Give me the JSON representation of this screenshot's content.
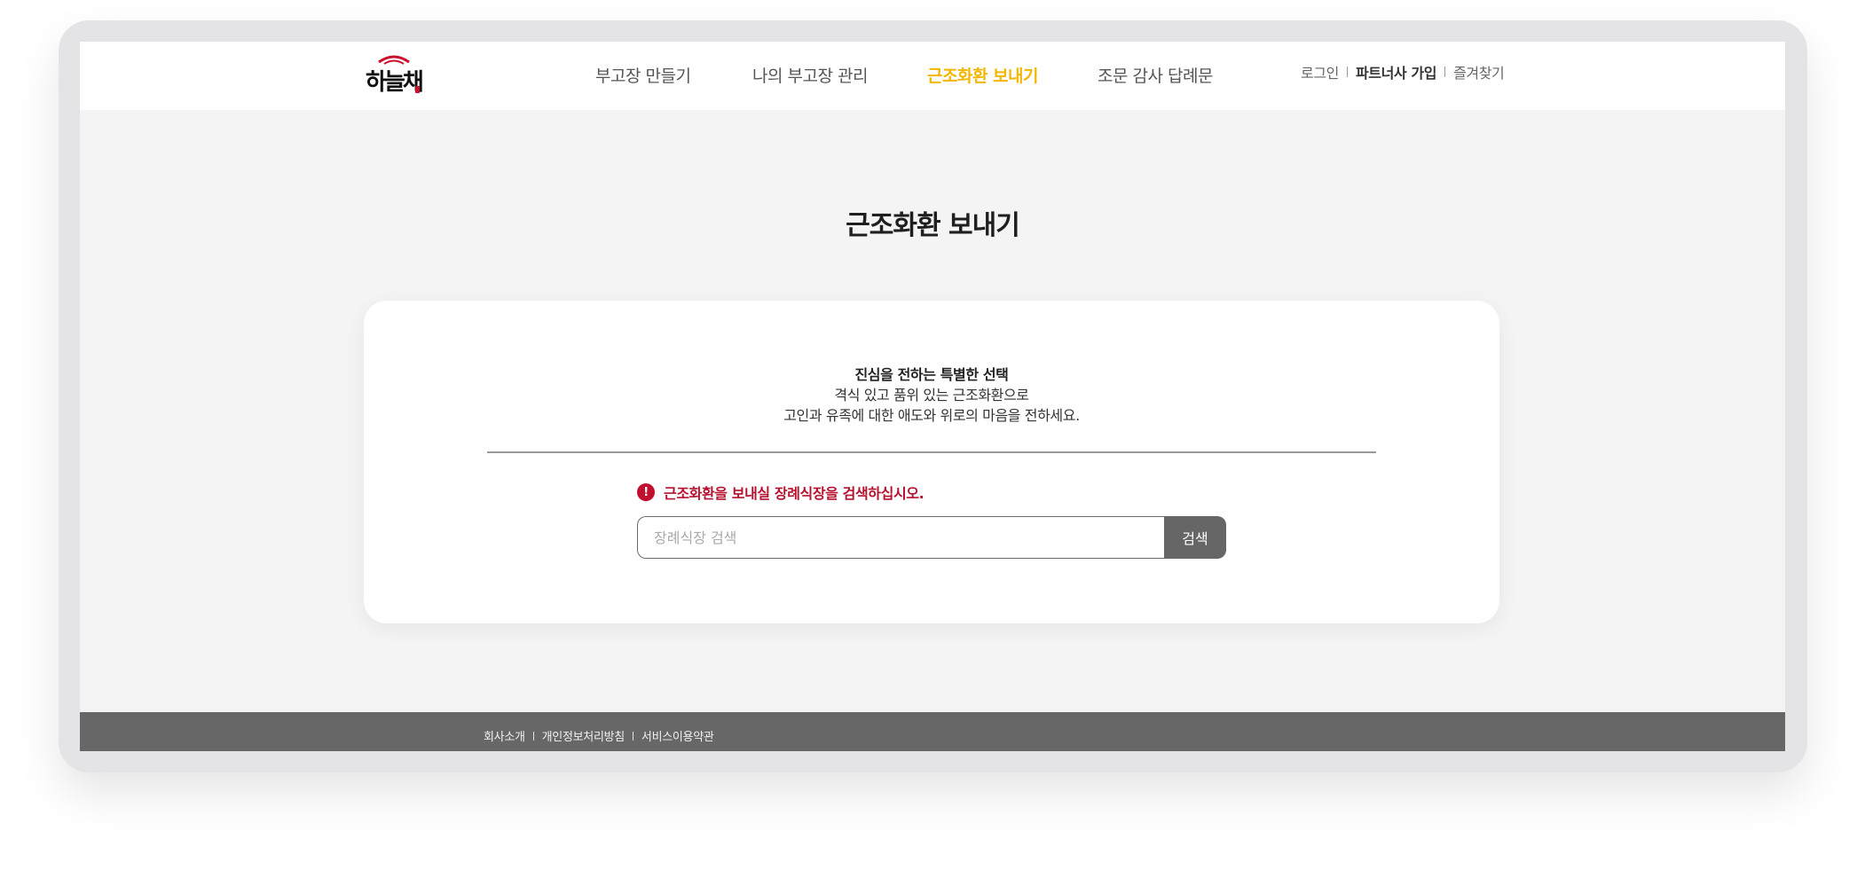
{
  "brand": {
    "logo_text": "하늘채"
  },
  "nav": {
    "items": [
      "부고장 만들기",
      "나의 부고장 관리",
      "근조화환 보내기",
      "조문 감사 답례문"
    ],
    "active_index": 2
  },
  "util": {
    "login": "로그인",
    "partner_signup": "파트너사 가입",
    "bookmark": "즐겨찾기"
  },
  "page": {
    "title": "근조화환 보내기"
  },
  "card": {
    "lead": "진심을 전하는 특별한 선택",
    "line1": "격식 있고 품위 있는 근조화환으로",
    "line2": "고인과 유족에 대한 애도와 위로의 마음을 전하세요.",
    "notice": "근조화환을 보내실 장례식장을 검색하십시오.",
    "notice_icon": "!",
    "search_placeholder": "장례식장 검색",
    "search_button": "검색"
  },
  "footer": {
    "links": [
      "회사소개",
      "개인정보처리방침",
      "서비스이용약관"
    ]
  },
  "colors": {
    "accent": "#f2b705",
    "alert": "#b5122f",
    "footer_bg": "#676767",
    "button_bg": "#666666"
  }
}
